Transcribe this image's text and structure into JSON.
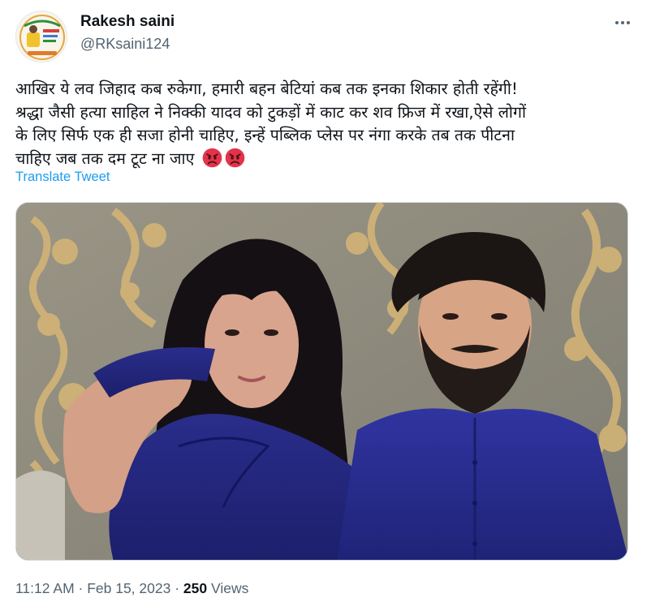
{
  "author": {
    "display_name": "Rakesh saini",
    "handle": "@RKsaini124"
  },
  "tweet": {
    "lines": [
      "आखिर ये लव जिहाद कब रुकेगा, हमारी बहन बेटियां कब तक इनका शिकार होती रहेंगी!",
      "श्रद्धा जैसी हत्या साहिल ने निक्की यादव को टुकड़ों में काट कर शव फ्रिज में रखा,ऐसे लोगों",
      "के लिए सिर्फ एक ही सजा होनी चाहिए, इन्हें पब्लिक प्लेस पर नंगा करके तब तक पीटना",
      "चाहिए जब तक दम टूट ना जाए"
    ],
    "emojis": [
      "angry-face-icon",
      "angry-face-icon"
    ],
    "translate_label": "Translate Tweet"
  },
  "meta": {
    "time": "11:12 AM",
    "separator": " · ",
    "date": "Feb 15, 2023",
    "views_count": "250",
    "views_label": " Views"
  },
  "colors": {
    "link": "#1d9bf0",
    "secondary_text": "#536471",
    "primary_text": "#0f1419"
  }
}
